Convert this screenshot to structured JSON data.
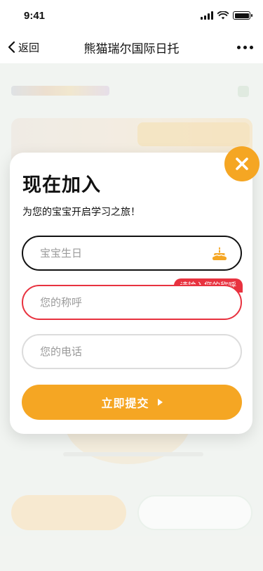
{
  "status_bar": {
    "time": "9:41",
    "icons": [
      "signal-icon",
      "wifi-icon",
      "battery-icon"
    ]
  },
  "nav": {
    "back_label": "返回",
    "title": "熊猫瑞尔国际日托",
    "more_icon": "more-dots-icon"
  },
  "modal": {
    "title": "现在加入",
    "subtitle": "为您的宝宝开启学习之旅！",
    "fields": {
      "birthday": {
        "placeholder": "宝宝生日",
        "value": "",
        "icon": "cake-icon"
      },
      "name": {
        "placeholder": "您的称呼",
        "value": "",
        "error": "请输入您的称呼"
      },
      "phone": {
        "placeholder": "您的电话",
        "value": ""
      }
    },
    "submit_label": "立即提交",
    "close_icon": "close-icon"
  },
  "colors": {
    "accent": "#f5a623",
    "error": "#e8323f",
    "text": "#111111",
    "placeholder": "#9a9a9a"
  }
}
